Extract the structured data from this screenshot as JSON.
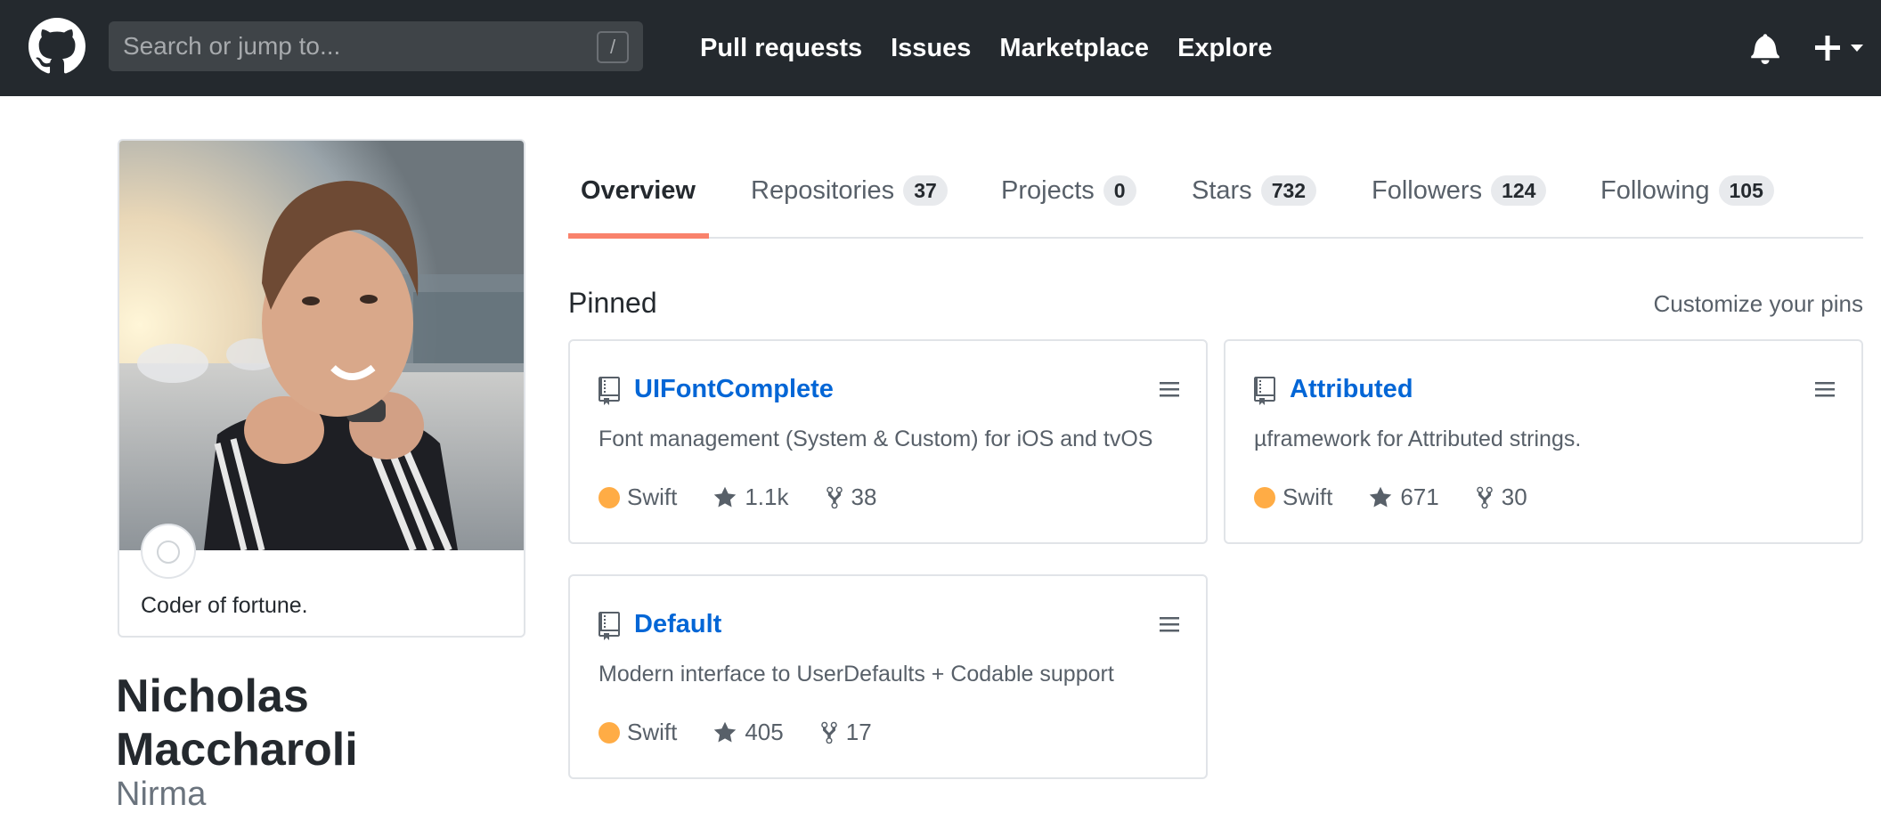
{
  "header": {
    "search_placeholder": "Search or jump to...",
    "search_shortcut": "/",
    "nav": [
      "Pull requests",
      "Issues",
      "Marketplace",
      "Explore"
    ]
  },
  "profile": {
    "bio": "Coder of fortune.",
    "name_line1": "Nicholas",
    "name_line2": "Maccharoli",
    "username": "Nirma"
  },
  "tabs": [
    {
      "label": "Overview",
      "count": ""
    },
    {
      "label": "Repositories",
      "count": "37"
    },
    {
      "label": "Projects",
      "count": "0"
    },
    {
      "label": "Stars",
      "count": "732"
    },
    {
      "label": "Followers",
      "count": "124"
    },
    {
      "label": "Following",
      "count": "105"
    }
  ],
  "pinned": {
    "title": "Pinned",
    "customize": "Customize your pins",
    "repos": [
      {
        "name": "UIFontComplete",
        "description": "Font management (System & Custom) for iOS and tvOS",
        "language": "Swift",
        "language_color": "#ffac45",
        "stars": "1.1k",
        "forks": "38"
      },
      {
        "name": "Attributed",
        "description": "µframework for Attributed strings.",
        "language": "Swift",
        "language_color": "#ffac45",
        "stars": "671",
        "forks": "30"
      },
      {
        "name": "Default",
        "description": "Modern interface to UserDefaults + Codable support",
        "language": "Swift",
        "language_color": "#ffac45",
        "stars": "405",
        "forks": "17"
      }
    ]
  },
  "colors": {
    "header_bg": "#24292e",
    "link": "#0366d6",
    "tab_underline": "#f9826c",
    "swift": "#ffac45"
  },
  "icons": [
    "github-logo-icon",
    "bell-icon",
    "plus-icon",
    "chevron-down-icon",
    "repo-icon",
    "menu-icon",
    "star-icon",
    "fork-icon"
  ]
}
